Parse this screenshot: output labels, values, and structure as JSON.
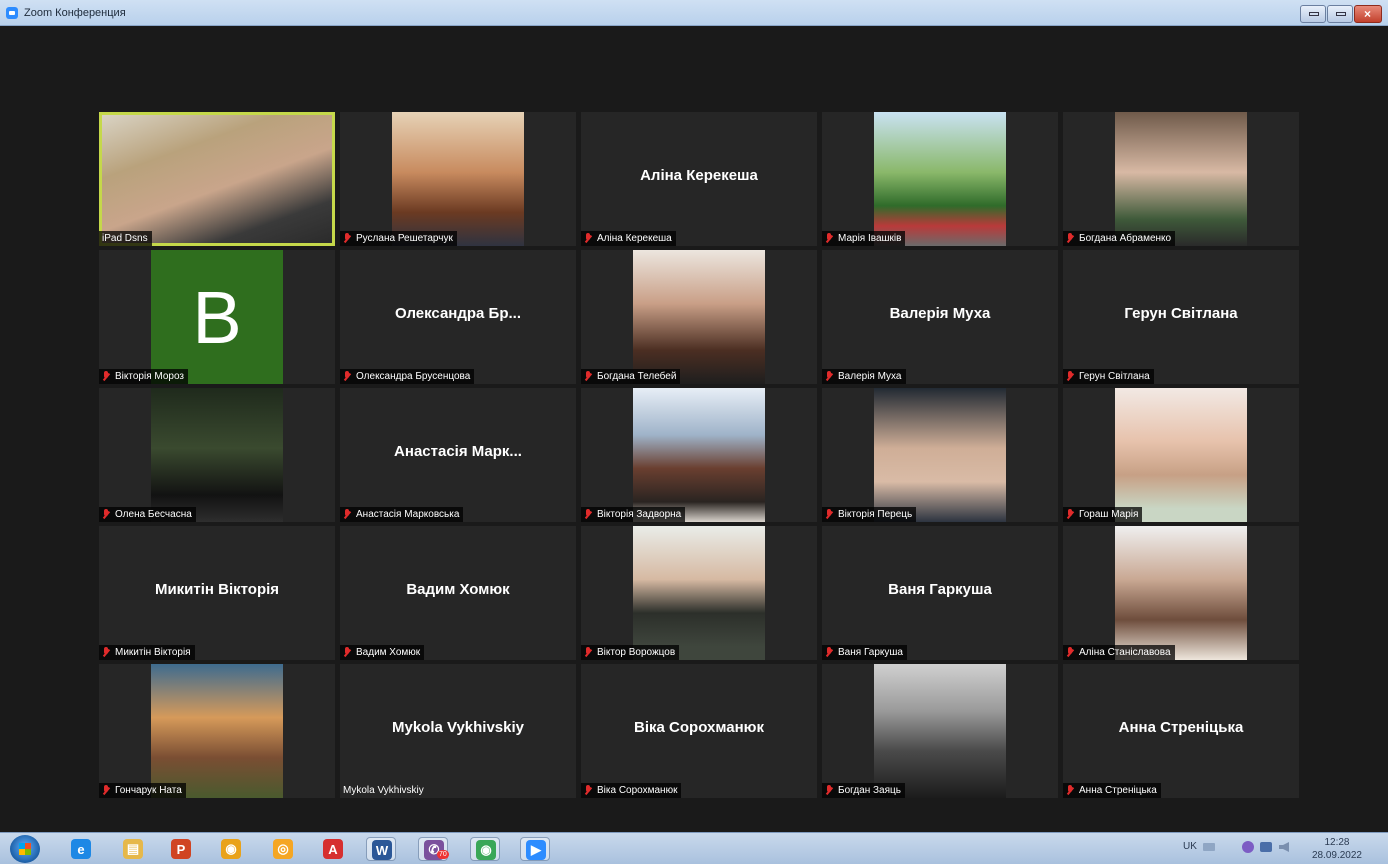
{
  "window": {
    "title": "Zoom Конференция"
  },
  "colors": {
    "active_speaker_border": "#c5d84a",
    "muted_mic": "#e02b2b",
    "tile_bg": "#262626",
    "avatar_bg": "#2f6e1e"
  },
  "participants": [
    {
      "name": "iPad Dsns",
      "muted": false,
      "video": true,
      "active": true
    },
    {
      "name": "Руслана Решетарчук",
      "muted": true,
      "video": true
    },
    {
      "name": "Аліна Керекеша",
      "muted": true,
      "video": false,
      "display_name": "Аліна Керекеша"
    },
    {
      "name": "Марія Івашків",
      "muted": true,
      "video": true
    },
    {
      "name": "Богдана Абраменко",
      "muted": true,
      "video": true
    },
    {
      "name": "Вікторія Мороз",
      "muted": true,
      "video": false,
      "avatar_letter": "B"
    },
    {
      "name": "Олександра Брусенцова",
      "muted": true,
      "video": false,
      "display_name": "Олександра Бр..."
    },
    {
      "name": "Богдана Телебей",
      "muted": true,
      "video": true
    },
    {
      "name": "Валерія Муха",
      "muted": true,
      "video": false,
      "display_name": "Валерія Муха"
    },
    {
      "name": "Герун Світлана",
      "muted": true,
      "video": false,
      "display_name": "Герун Світлана"
    },
    {
      "name": "Олена Бесчасна",
      "muted": true,
      "video": true
    },
    {
      "name": "Анастасія Марковська",
      "muted": true,
      "video": false,
      "display_name": "Анастасія Марк..."
    },
    {
      "name": "Вікторія Задворна",
      "muted": true,
      "video": true
    },
    {
      "name": "Вікторія Перець",
      "muted": true,
      "video": true
    },
    {
      "name": "Гораш Марія",
      "muted": true,
      "video": true
    },
    {
      "name": "Микитін Вікторія",
      "muted": true,
      "video": false,
      "display_name": "Микитін Вікторія"
    },
    {
      "name": "Вадим Хомюк",
      "muted": true,
      "video": false,
      "display_name": "Вадим Хомюк"
    },
    {
      "name": "Віктор Ворожцов",
      "muted": true,
      "video": true
    },
    {
      "name": "Ваня Гаркуша",
      "muted": true,
      "video": false,
      "display_name": "Ваня Гаркуша"
    },
    {
      "name": "Аліна Станіславова",
      "muted": true,
      "video": true
    },
    {
      "name": "Гончарук Ната",
      "muted": true,
      "video": true
    },
    {
      "name": "Mykola Vykhivskiy",
      "muted": false,
      "video": false,
      "display_name": "Mykola Vykhivskiy"
    },
    {
      "name": "Віка Сорохманюк",
      "muted": true,
      "video": false,
      "display_name": "Віка Сорохманюк"
    },
    {
      "name": "Богдан Заяць",
      "muted": true,
      "video": true
    },
    {
      "name": "Анна Стреніцька",
      "muted": true,
      "video": false,
      "display_name": "Анна Стреніцька"
    }
  ],
  "taskbar": {
    "apps": [
      {
        "name": "internet-explorer-icon",
        "glyph": "e",
        "color": "#1e88e5"
      },
      {
        "name": "file-explorer-icon",
        "glyph": "▤",
        "color": "#e6b84a"
      },
      {
        "name": "powerpoint-icon",
        "glyph": "P",
        "color": "#d04423"
      },
      {
        "name": "chrome-icon",
        "glyph": "◉",
        "color": "#e9a21a"
      },
      {
        "name": "yandex-browser-icon",
        "glyph": "◎",
        "color": "#f5a623"
      },
      {
        "name": "acrobat-icon",
        "glyph": "A",
        "color": "#d62f2f"
      },
      {
        "name": "word-icon",
        "glyph": "W",
        "color": "#2b5797"
      },
      {
        "name": "viber-icon",
        "glyph": "✆",
        "color": "#7b519d",
        "badge": "70"
      },
      {
        "name": "chrome-profile-icon",
        "glyph": "◉",
        "color": "#3aa757"
      },
      {
        "name": "zoom-icon",
        "glyph": "▶",
        "color": "#2d8cff"
      }
    ],
    "tray": {
      "language": "UK",
      "time": "12:28",
      "date": "28.09.2022"
    }
  }
}
